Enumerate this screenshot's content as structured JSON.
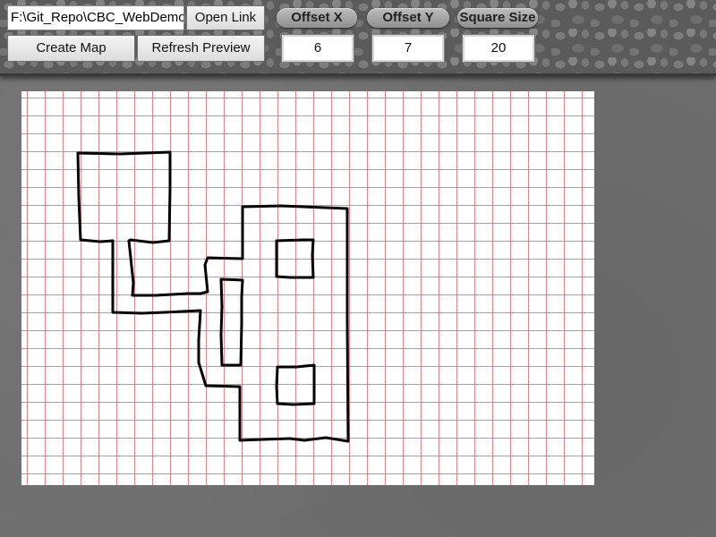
{
  "toolbar": {
    "path_value": "F:\\Git_Repo\\CBC_WebDemo",
    "open_link_label": "Open Link",
    "create_map_label": "Create Map",
    "refresh_preview_label": "Refresh Preview",
    "offset_x_label": "Offset X",
    "offset_y_label": "Offset Y",
    "square_size_label": "Square Size",
    "offset_x_value": "6",
    "offset_y_value": "7",
    "square_size_value": "20"
  },
  "colors": {
    "grid_line": "#e85860",
    "toolbar_stone": "#5b5b5b",
    "background": "#6f6f6f",
    "map_stroke": "#000000"
  }
}
